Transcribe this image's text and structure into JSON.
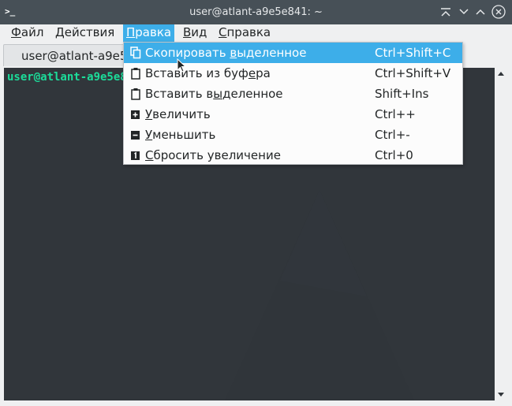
{
  "window": {
    "title": "user@atlant-a9e5e841: ~",
    "app_icon_glyph": ">_"
  },
  "menubar": {
    "items": [
      {
        "pre": "",
        "mn": "Ф",
        "post": "айл"
      },
      {
        "pre": "",
        "mn": "Д",
        "post": "ействия"
      },
      {
        "pre": "",
        "mn": "П",
        "post": "равка"
      },
      {
        "pre": "",
        "mn": "В",
        "post": "ид"
      },
      {
        "pre": "",
        "mn": "С",
        "post": "правка"
      }
    ]
  },
  "tab": {
    "label": "user@atlant-a9e5e841: ~"
  },
  "terminal": {
    "prompt": "user@atlant-a9e5e841",
    "prompt_color": "#1cdc9a",
    "background": "#31363b"
  },
  "edit_menu": {
    "items": [
      {
        "pre": "Скопировать ",
        "mn": "в",
        "post": "ыделенное",
        "shortcut": "Ctrl+Shift+C",
        "icon": "copy-icon"
      },
      {
        "pre": "Вставить из буф",
        "mn": "е",
        "post": "ра",
        "shortcut": "Ctrl+Shift+V",
        "icon": "paste-icon"
      },
      {
        "pre": "Вставить в",
        "mn": "ы",
        "post": "деленное",
        "shortcut": "Shift+Ins",
        "icon": "paste-selection-icon"
      },
      {
        "pre": "",
        "mn": "У",
        "post": "величить",
        "shortcut": "Ctrl++",
        "icon": "zoom-in-icon"
      },
      {
        "pre": "",
        "mn": "У",
        "post": "меньшить",
        "shortcut": "Ctrl+-",
        "icon": "zoom-out-icon"
      },
      {
        "pre": "",
        "mn": "С",
        "post": "бросить увеличение",
        "shortcut": "Ctrl+0",
        "icon": "zoom-reset-icon"
      }
    ]
  },
  "colors": {
    "accent": "#3daee9",
    "titlebar": "#475057",
    "window_bg": "#eff0f1"
  }
}
